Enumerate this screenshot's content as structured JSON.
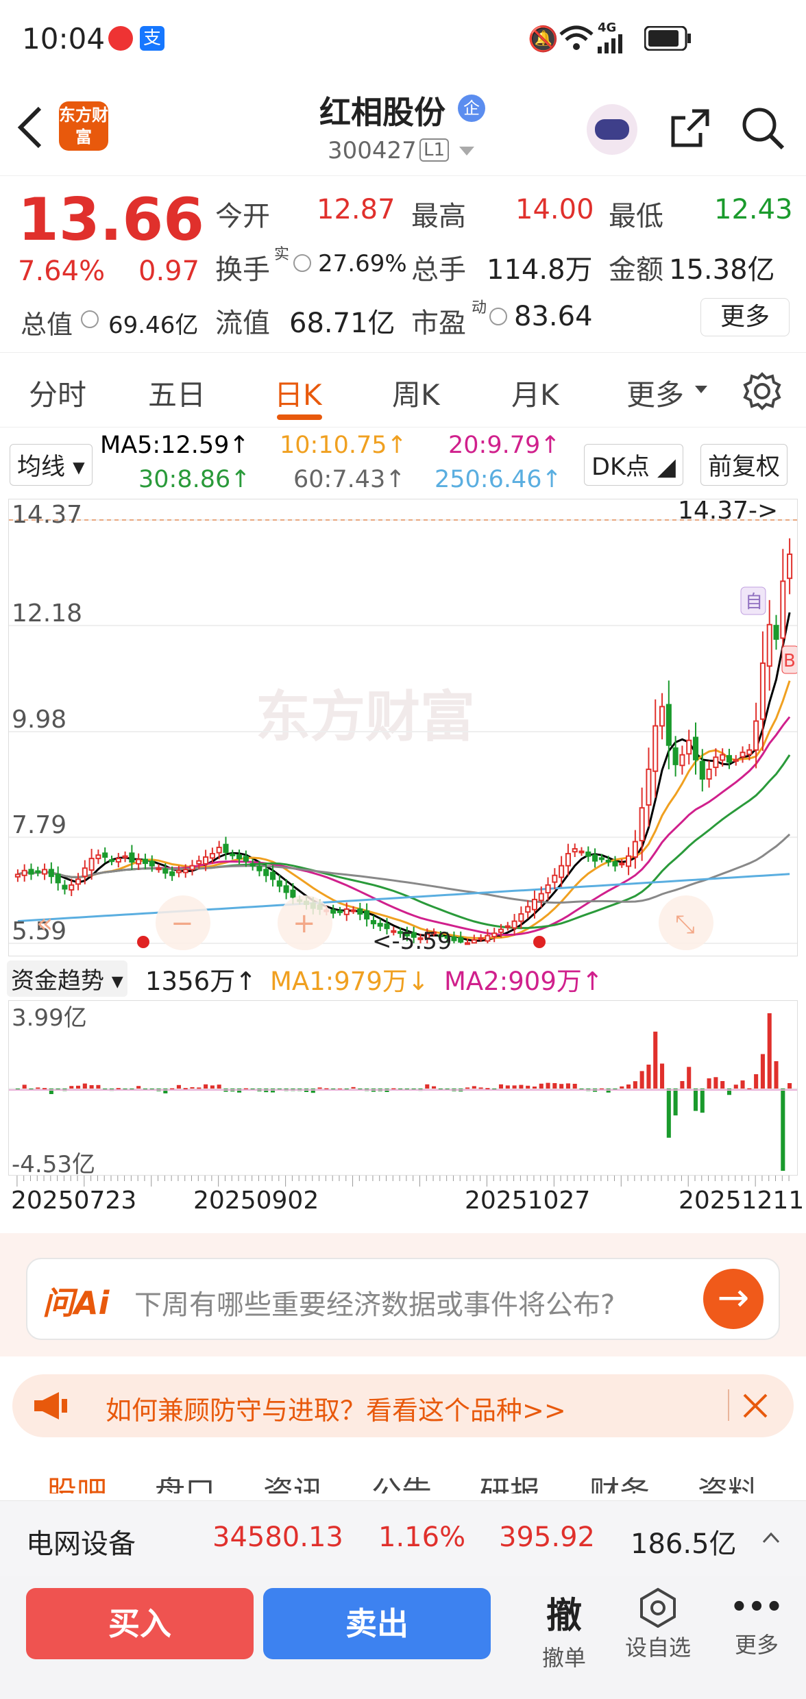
{
  "status_bar": {
    "time": "10:04",
    "signal_text": "4G"
  },
  "header": {
    "logo_text": "东方财富",
    "stock_name": "红相股份",
    "stock_code": "300427",
    "level": "L1"
  },
  "quote": {
    "price": "13.66",
    "change_pct": "7.64%",
    "change_amt": "0.97",
    "open_label": "今开",
    "open": "12.87",
    "high_label": "最高",
    "high": "14.00",
    "low_label": "最低",
    "low": "12.43",
    "turnover_label": "换手",
    "turnover_sup": "实",
    "turnover": "27.69%",
    "volume_label": "总手",
    "volume": "114.8万",
    "amount_label": "金额",
    "amount": "15.38亿",
    "mktcap_label": "总值",
    "mktcap": "69.46亿",
    "float_label": "流值",
    "float": "68.71亿",
    "pe_label": "市盈",
    "pe_sup": "动",
    "pe": "83.64",
    "more": "更多"
  },
  "tabs": [
    "分时",
    "五日",
    "日K",
    "周K",
    "月K",
    "更多"
  ],
  "active_tab": "日K",
  "chart": {
    "ma_select": "均线",
    "ma5": "MA5:12.59↑",
    "ma10": "10:10.75↑",
    "ma20": "20:9.79↑",
    "ma30": "30:8.86↑",
    "ma60": "60:7.43↑",
    "ma250": "250:6.46↑",
    "dk": "DK点",
    "fq": "前复权",
    "yticks": [
      "14.37",
      "12.18",
      "9.98",
      "7.79",
      "5.59"
    ],
    "max_label": "14.37->",
    "min_label": "<-5.59",
    "watermark": "东方财富",
    "self_marker": "自",
    "b_marker": "B",
    "fund_select": "资金趋势",
    "fund_val": "1356万↑",
    "fund_ma1": "MA1:979万↓",
    "fund_ma2": "MA2:909万↑",
    "fund_top": "3.99亿",
    "fund_bottom": "-4.53亿",
    "dates": [
      "20250723",
      "20250902",
      "20251027",
      "20251211"
    ]
  },
  "chart_data": {
    "type": "candlestick",
    "ylim": [
      5.59,
      14.37
    ],
    "close": [
      7.02,
      7.1,
      7.03,
      7.07,
      7.12,
      6.98,
      6.85,
      6.72,
      6.8,
      6.92,
      7.15,
      7.35,
      7.42,
      7.38,
      7.3,
      7.35,
      7.4,
      7.28,
      7.33,
      7.25,
      7.2,
      7.15,
      7.05,
      7.0,
      7.1,
      7.12,
      7.2,
      7.3,
      7.38,
      7.45,
      7.58,
      7.48,
      7.42,
      7.35,
      7.3,
      7.2,
      7.1,
      7.0,
      6.92,
      6.78,
      6.65,
      6.55,
      6.48,
      6.4,
      6.32,
      6.3,
      6.28,
      6.22,
      6.25,
      6.3,
      6.28,
      6.2,
      6.1,
      6.0,
      5.95,
      5.9,
      5.85,
      5.8,
      5.75,
      5.72,
      5.7,
      5.78,
      5.82,
      5.75,
      5.7,
      5.65,
      5.62,
      5.6,
      5.66,
      5.7,
      5.75,
      5.8,
      5.88,
      5.95,
      6.05,
      6.2,
      6.35,
      6.5,
      6.62,
      6.8,
      7.0,
      7.2,
      7.45,
      7.55,
      7.5,
      7.4,
      7.3,
      7.35,
      7.28,
      7.2,
      7.25,
      7.4,
      7.7,
      8.4,
      9.2,
      10.1,
      10.5,
      9.7,
      9.3,
      9.5,
      9.8,
      9.4,
      9.0,
      9.2,
      9.45,
      9.5,
      9.35,
      9.4,
      9.55,
      9.6,
      10.2,
      11.4,
      12.2,
      11.9,
      13.1,
      13.66
    ]
  },
  "ai_box": {
    "logo": "问Ai",
    "placeholder": "下周有哪些重要经济数据或事件将公布?"
  },
  "banner": {
    "text": "如何兼顾防守与进取？看看这个品种>>"
  },
  "subtabs": [
    "股吧",
    "盘口",
    "资讯",
    "公告",
    "研报",
    "财务",
    "资料"
  ],
  "sector": {
    "name": "电网设备",
    "index": "34580.13",
    "pct": "1.16%",
    "chg": "395.92",
    "amount": "186.5亿"
  },
  "bottom": {
    "buy": "买入",
    "sell": "卖出",
    "cancel_icon": "撤",
    "cancel": "撤单",
    "watch": "设自选",
    "more": "更多"
  },
  "colors": {
    "up": "#e0302c",
    "down": "#1a9a2c",
    "accent": "#e8590c",
    "ma5": "#000000",
    "ma10": "#f0a020",
    "ma20": "#d0208c",
    "ma30": "#2a9a3a",
    "ma60": "#888888",
    "ma250": "#5aaee0"
  }
}
